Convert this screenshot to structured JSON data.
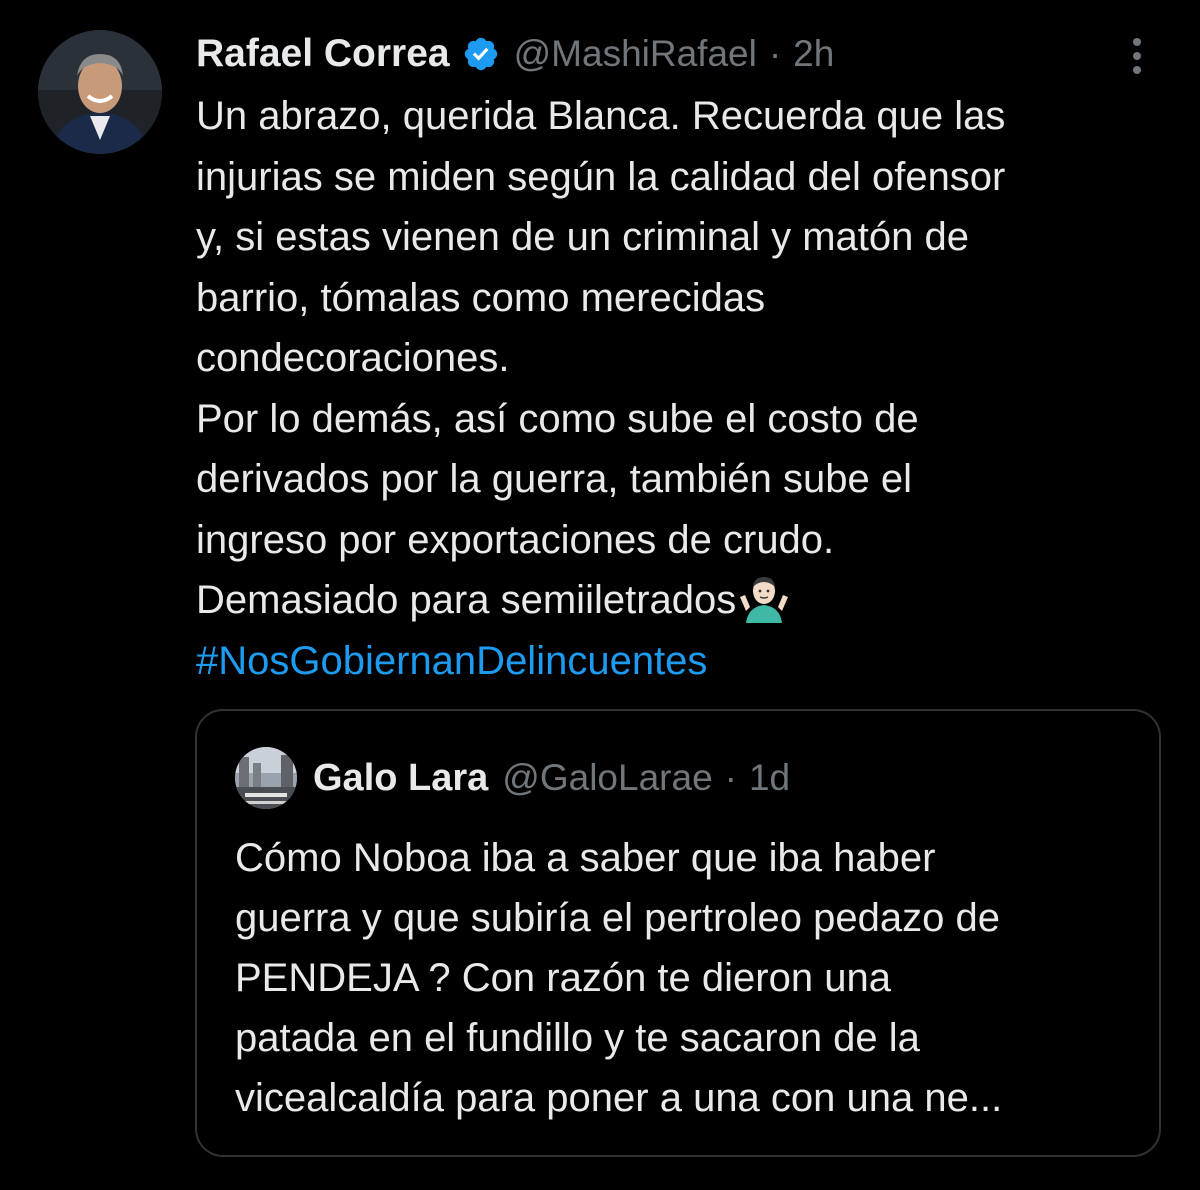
{
  "tweet": {
    "author": {
      "name": "Rafael Correa",
      "handle": "@MashiRafael",
      "verified": true,
      "avatar_icon": "person-photo-avatar"
    },
    "separator": "·",
    "timestamp": "2h",
    "body_lines": [
      "Un abrazo, querida Blanca. Recuerda que las",
      "injurias se miden según la calidad del ofensor",
      "y, si estas vienen de un criminal y matón de",
      "barrio, tómalas como merecidas",
      "condecoraciones.",
      "Por lo demás, así como sube el costo de",
      "derivados por la guerra, también sube el",
      "ingreso por exportaciones de crudo.",
      "Demasiado para semiiletrados"
    ],
    "emoji": "person-shrugging-emoji",
    "hashtag": "#NosGobiernanDelincuentes",
    "more_icon": "more-vertical-icon"
  },
  "quoted_tweet": {
    "author": {
      "name": "Galo Lara",
      "handle": "@GaloLarae",
      "avatar_icon": "street-photo-avatar"
    },
    "separator": "·",
    "timestamp": "1d",
    "body_lines": [
      "Cómo Noboa iba a saber que iba haber",
      "guerra y que subiría el pertroleo pedazo de",
      "PENDEJA ? Con razón te dieron una",
      "patada en el fundillo y te sacaron de la",
      "vicealcaldía para poner a una con una ne..."
    ]
  },
  "colors": {
    "background": "#000000",
    "text": "#e7e9ea",
    "secondary_text": "#71767b",
    "link": "#1d9bf0",
    "verified": "#1d9bf0",
    "quote_border": "#2f3336"
  }
}
